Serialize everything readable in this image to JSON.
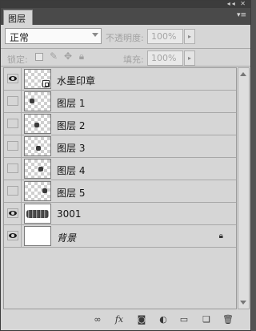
{
  "panel": {
    "tab_label": "图层",
    "window_controls": "◂◂ ✕",
    "tab_menu": "▾≡"
  },
  "blend_mode": {
    "value": "正常"
  },
  "opacity": {
    "label": "不透明度:",
    "value": "100%"
  },
  "lock": {
    "label": "锁定:"
  },
  "fill": {
    "label": "填充:",
    "value": "100%"
  },
  "layers": [
    {
      "name": "水墨印章",
      "visible": true,
      "thumb": "smart-object"
    },
    {
      "name": "图层 1",
      "visible": false,
      "thumb": "transparent"
    },
    {
      "name": "图层 2",
      "visible": false,
      "thumb": "transparent"
    },
    {
      "name": "图层 3",
      "visible": false,
      "thumb": "transparent"
    },
    {
      "name": "图层 4",
      "visible": false,
      "thumb": "transparent"
    },
    {
      "name": "图层 5",
      "visible": false,
      "thumb": "transparent"
    },
    {
      "name": "3001",
      "visible": true,
      "thumb": "ink-texture"
    },
    {
      "name": "背景",
      "visible": true,
      "thumb": "white",
      "locked": true
    }
  ],
  "footer_icons": [
    "link-icon",
    "fx-icon",
    "mask-icon",
    "adjustment-icon",
    "group-folder-icon",
    "new-layer-icon",
    "trash-icon"
  ],
  "footer_fx": "fx"
}
